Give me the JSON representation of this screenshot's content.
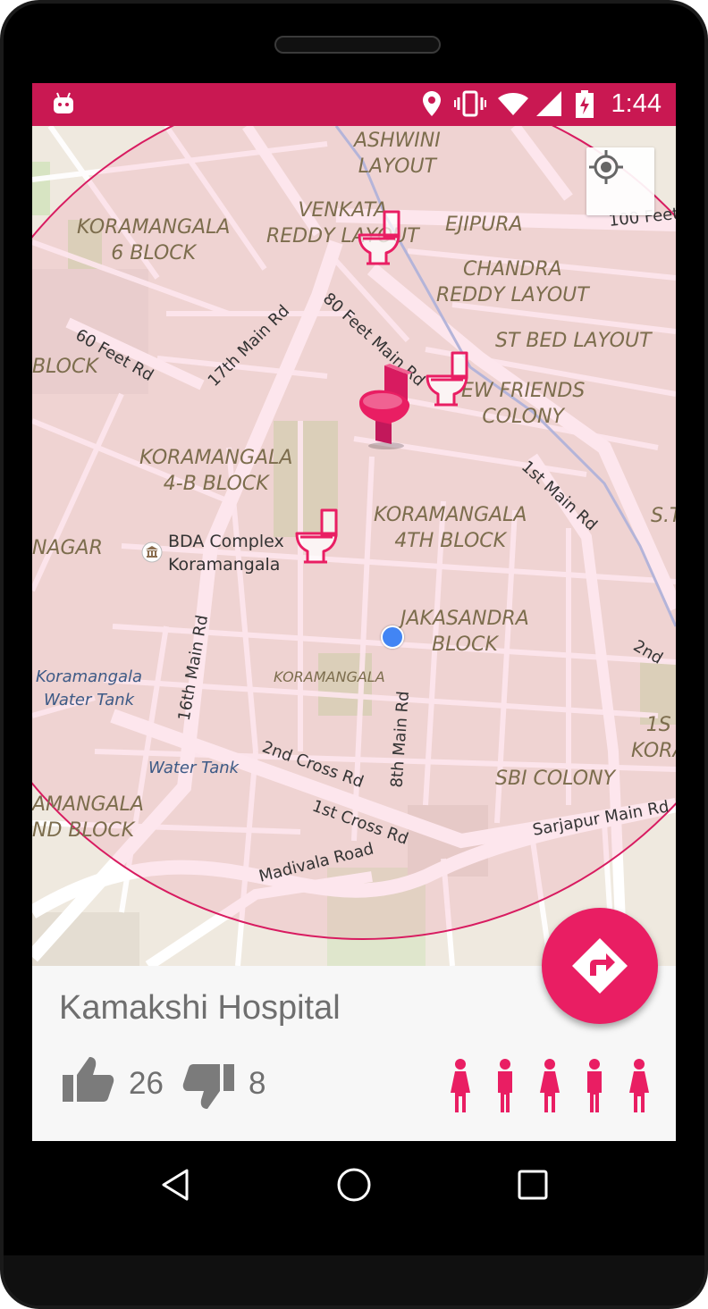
{
  "status_bar": {
    "time": "1:44",
    "icons": [
      "android-debug-icon",
      "location-pin-icon",
      "vibrate-icon",
      "wifi-icon",
      "signal-icon",
      "battery-charging-icon"
    ]
  },
  "map": {
    "area_labels": [
      {
        "id": "ashwini",
        "text": "ASHWINI\nLAYOUT"
      },
      {
        "id": "venkata",
        "text": "VENKATA\nREDDY LAYOUT"
      },
      {
        "id": "ejipura",
        "text": "EJIPURA"
      },
      {
        "id": "kor6",
        "text": "KORAMANGALA\n6 BLOCK"
      },
      {
        "id": "chandra",
        "text": "CHANDRA\nREDDY LAYOUT"
      },
      {
        "id": "stbed",
        "text": "ST BED LAYOUT"
      },
      {
        "id": "newfriends",
        "text": "EW FRIENDS\nCOLONY"
      },
      {
        "id": "block",
        "text": "BLOCK"
      },
      {
        "id": "kor4b",
        "text": "KORAMANGALA\n4-B BLOCK"
      },
      {
        "id": "kor4th",
        "text": "KORAMANGALA\n4TH BLOCK"
      },
      {
        "id": "nagar",
        "text": "NAGAR"
      },
      {
        "id": "st",
        "text": "S.T"
      },
      {
        "id": "jakasandra",
        "text": "JAKASANDRA\nBLOCK"
      },
      {
        "id": "koramangala_small",
        "text": "KORAMANGALA"
      },
      {
        "id": "1s_kora",
        "text": "1S\nKORA"
      },
      {
        "id": "sbi",
        "text": "SBI COLONY"
      },
      {
        "id": "amangala",
        "text": "AMANGALA\nND BLOCK"
      }
    ],
    "road_labels": [
      {
        "id": "100feet",
        "text": "100 Feet"
      },
      {
        "id": "60feet",
        "text": "60 Feet Rd"
      },
      {
        "id": "17th",
        "text": "17th Main Rd"
      },
      {
        "id": "80feet",
        "text": "80 Feet Main Rd"
      },
      {
        "id": "1stmain",
        "text": "1st Main Rd"
      },
      {
        "id": "16th",
        "text": "16th Main Rd"
      },
      {
        "id": "2ndcross",
        "text": "2nd Cross Rd"
      },
      {
        "id": "1stcross",
        "text": "1st Cross Rd"
      },
      {
        "id": "8thmain",
        "text": "8th Main Rd"
      },
      {
        "id": "2nd",
        "text": "2nd"
      },
      {
        "id": "sarjapur",
        "text": "Sarjapur Main Rd"
      },
      {
        "id": "madivala",
        "text": "Madivala Road"
      }
    ],
    "water_labels": [
      {
        "id": "watertank1",
        "text": "Koramangala\nWater Tank"
      },
      {
        "id": "watertank2",
        "text": "Water Tank"
      }
    ],
    "poi": {
      "text": "BDA Complex\nKoramangala"
    },
    "accent_color": "#e91e63"
  },
  "place": {
    "name": "Kamakshi Hospital",
    "upvotes": "26",
    "downvotes": "8",
    "genders": [
      "female",
      "male",
      "female",
      "male",
      "female"
    ]
  }
}
